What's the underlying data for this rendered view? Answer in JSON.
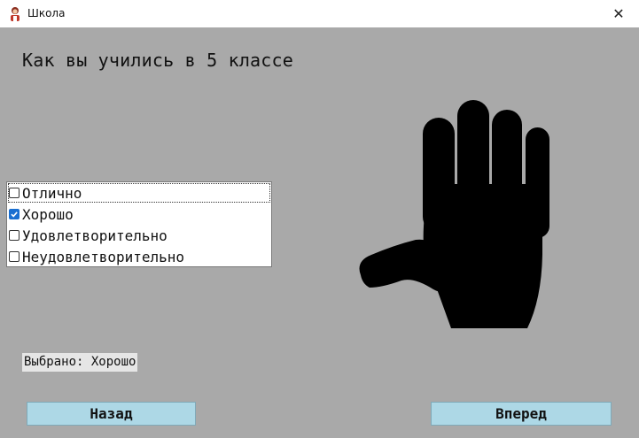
{
  "window": {
    "title": "Школа",
    "close_glyph": "✕"
  },
  "question": {
    "text": "Как вы учились в 5 классе"
  },
  "options": [
    {
      "label": "Отлично",
      "checked": false
    },
    {
      "label": "Хорошо",
      "checked": true
    },
    {
      "label": "Удовлетворительно",
      "checked": false
    },
    {
      "label": "Неудовлетворительно",
      "checked": false
    }
  ],
  "status": {
    "selected_text": "Выбрано: Хорошо"
  },
  "buttons": {
    "back_label": "Назад",
    "next_label": "Вперед"
  },
  "icons": {
    "app": "school-app-icon",
    "close": "close-icon",
    "illustration": "hand-icon"
  },
  "colors": {
    "client_bg": "#a9a9a9",
    "button_bg": "#add8e6",
    "checkbox_accent": "#1a6fd1"
  }
}
